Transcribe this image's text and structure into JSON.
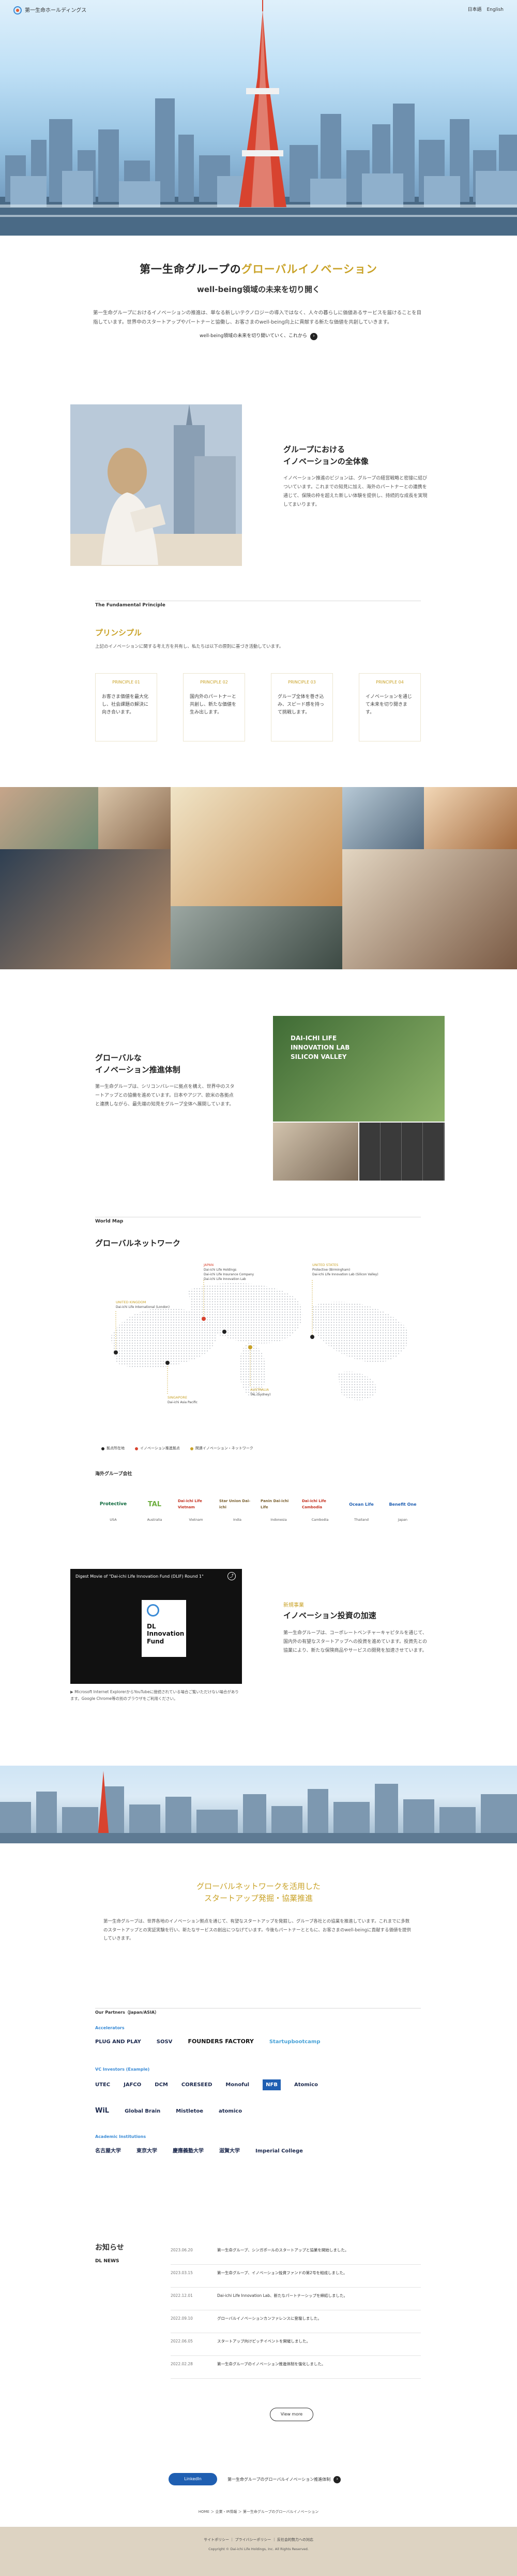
{
  "header": {
    "logo_text": "第一生命ホールディングス",
    "link_1": "日本語",
    "link_2": "English"
  },
  "intro": {
    "title_prefix": "第一生命グループの",
    "title_accent": "グローバルイノベーション",
    "subtitle": "well-being領域の未来を切り開く",
    "body": "第一生命グループにおけるイノベーションの推進は、単なる新しいテクノロジーの導入ではなく、人々の暮らしに価値あるサービスを届けることを目指しています。世界中のスタートアップやパートナーと協働し、お客さまのwell-being向上に貢献する新たな価値を共創していきます。",
    "link_text": "well-being領域の未来を切り開いていく、これから"
  },
  "overview": {
    "title_line1": "グループにおける",
    "title_line2": "イノベーションの全体像",
    "body": "イノベーション推進のビジョンは、グループの経営戦略と密接に結びついています。これまでの知見に加え、海外のパートナーとの連携を通じて、保険の枠を超えた新しい体験を提供し、持続的な成長を実現してまいります。"
  },
  "principle": {
    "label_en": "The Fundamental Principle",
    "title": "プリンシプル",
    "lead": "上記のイノベーションに関する考え方を共有し、私たちは以下の原則に基づき活動しています。",
    "cards": [
      {
        "tag": "PRINCIPLE 01",
        "text": "お客さま価値を最大化し、社会課題の解決に向き合います。"
      },
      {
        "tag": "PRINCIPLE 02",
        "text": "国内外のパートナーと共創し、新たな価値を生み出します。"
      },
      {
        "tag": "PRINCIPLE 03",
        "text": "グループ全体を巻き込み、スピード感を持って挑戦します。"
      },
      {
        "tag": "PRINCIPLE 04",
        "text": "イノベーションを通じて未来を切り開きます。"
      }
    ]
  },
  "promotion": {
    "title_line1": "グローバルな",
    "title_line2": "イノベーション推進体制",
    "body": "第一生命グループは、シリコンバレーに拠点を構え、世界中のスタートアップとの協働を進めています。日本やアジア、欧米の各拠点と連携しながら、最先端の知見をグループ全体へ展開しています。",
    "panel_sign": "DAI-ICHI LIFE INNOVATION LAB SILICON VALLEY"
  },
  "network": {
    "label_en": "World Map",
    "title": "グローバルネットワーク",
    "regions": [
      {
        "name": "UNITED KINGDOM",
        "items": [
          "Dai-ichi Life International (London)"
        ]
      },
      {
        "name": "JAPAN",
        "items": [
          "Dai-ichi Life Holdings",
          "Dai-ichi Life Insurance Company",
          "Dai-ichi Life Innovation Lab"
        ]
      },
      {
        "name": "UNITED STATES",
        "items": [
          "Protective (Birmingham)",
          "Dai-ichi Life Innovation Lab (Silicon Valley)"
        ]
      },
      {
        "name": "SINGAPORE",
        "items": [
          "Dai-ichi Asia Pacific"
        ]
      },
      {
        "name": "AUSTRALIA",
        "items": [
          "TAL (Sydney)"
        ]
      }
    ],
    "legend": [
      "拠点所在地",
      "イノベーション推進拠点",
      "関連イノベーション・ネットワーク"
    ],
    "partners_label": "海外グループ会社",
    "partners": [
      {
        "name": "Protective",
        "country": "USA"
      },
      {
        "name": "TAL",
        "country": "Australia"
      },
      {
        "name": "Dai-ichi Life Vietnam",
        "country": "Vietnam"
      },
      {
        "name": "Star Union Dai-ichi",
        "country": "India"
      },
      {
        "name": "Panin Dai-ichi Life",
        "country": "Indonesia"
      },
      {
        "name": "Dai-ichi Life Cambodia",
        "country": "Cambodia"
      },
      {
        "name": "Ocean Life",
        "country": "Thailand"
      },
      {
        "name": "Benefit One",
        "country": "Japan"
      }
    ]
  },
  "fund": {
    "video_title": "Digest Movie of \"Dai-ichi Life Innovation Fund (DLIF) Round 1\"",
    "video_logo": "DL Innovation Fund",
    "caption": "▶ Microsoft Internet ExplorerからYouTubeに接続されている場合ご覧いただけない場合があります。Google Chrome等の別のブラウザをご利用ください。",
    "kicker": "新規事業",
    "title": "イノベーション投資の加速",
    "body": "第一生命グループは、コーポレートベンチャーキャピタルを通じて、国内外の有望なスタートアップへの投資を進めています。投資先との協業により、新たな保険商品やサービスの開発を加速させています。"
  },
  "startup": {
    "title_line1": "グローバルネットワークを活用した",
    "title_line2": "スタートアップ発掘・協業推進",
    "body": "第一生命グループは、世界各地のイノベーション拠点を通じて、有望なスタートアップを発掘し、グループ各社との協業を推進しています。これまでに多数のスタートアップとの実証実験を行い、新たなサービスの創出につなげています。今後もパートナーとともに、お客さまのwell-beingに貢献する価値を提供していきます。"
  },
  "logos": {
    "head": "Our Partners（Japan/ASIA）",
    "sub_1": "Accelerators",
    "row_1": [
      "PLUG AND PLAY",
      "SOSV",
      "FOUNDERS FACTORY",
      "Startupbootcamp"
    ],
    "sub_2": "VC Investors (Example)",
    "row_2": [
      "UTEC",
      "JAFCO",
      "DCM",
      "CORESEED",
      "Monoful",
      "NFB",
      "Atomico"
    ],
    "row_3": [
      "WiL",
      "Global Brain",
      "Mistletoe",
      "atomico"
    ],
    "sub_3": "Academic Institutions",
    "row_4": [
      "名古屋大学",
      "東京大学",
      "慶應義塾大学",
      "滋賀大学",
      "Imperial College"
    ]
  },
  "news": {
    "head": "お知らせ",
    "tag": "DL NEWS",
    "items": [
      {
        "date": "2023.06.20",
        "title": "第一生命グループ、シンガポールのスタートアップと協業を開始しました。"
      },
      {
        "date": "2023.03.15",
        "title": "第一生命グループ、イノベーション投資ファンドの第2号を組成しました。"
      },
      {
        "date": "2022.12.01",
        "title": "Dai-ichi Life Innovation Lab、新たなパートナーシップを締結しました。"
      },
      {
        "date": "2022.09.10",
        "title": "グローバルイノベーションカンファレンスに登壇しました。"
      },
      {
        "date": "2022.06.05",
        "title": "スタートアップ向けピッチイベントを開催しました。"
      },
      {
        "date": "2022.02.28",
        "title": "第一生命グループのイノベーション推進体制を強化しました。"
      }
    ],
    "more": "View more"
  },
  "bottom": {
    "linkedin": "LinkedIn",
    "group_link": "第一生命グループのグローバルイノベーション推進体制",
    "breadcrumb": "HOME ＞ 企業・IR情報 ＞ 第一生命グループのグローバルイノベーション"
  },
  "footer": {
    "links": "サイトポリシー ｜ プライバシーポリシー ｜ 反社会的勢力への対応",
    "copy": "Copyright © Dai-ichi Life Holdings, Inc. All Rights Reserved."
  }
}
